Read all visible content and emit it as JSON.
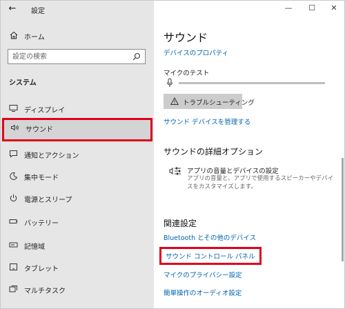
{
  "window": {
    "app_title": "設定",
    "back_icon": "arrow-left-icon",
    "controls": {
      "minimize_icon": "minimize-icon",
      "maximize_icon": "maximize-icon",
      "close_icon": "close-icon"
    }
  },
  "sidebar": {
    "home_label": "ホーム",
    "search_placeholder": "設定の検索",
    "section_title": "システム",
    "items": [
      {
        "label": "ディスプレイ",
        "icon": "display-icon"
      },
      {
        "label": "サウンド",
        "icon": "speaker-icon",
        "selected": true
      },
      {
        "label": "通知とアクション",
        "icon": "notification-icon"
      },
      {
        "label": "集中モード",
        "icon": "moon-icon"
      },
      {
        "label": "電源とスリープ",
        "icon": "power-icon"
      },
      {
        "label": "バッテリー",
        "icon": "battery-icon"
      },
      {
        "label": "記憶域",
        "icon": "storage-icon"
      },
      {
        "label": "タブレット",
        "icon": "tablet-icon"
      },
      {
        "label": "マルチタスク",
        "icon": "multitask-icon"
      }
    ]
  },
  "main": {
    "title": "サウンド",
    "device_properties_link": "デバイスのプロパティ",
    "mic_test_label": "マイクのテスト",
    "mic_level": 0,
    "troubleshoot_button": "トラブルシューティング",
    "manage_devices_link": "サウンド デバイスを管理する",
    "advanced_heading": "サウンドの詳細オプション",
    "app_volume_title": "アプリの音量とデバイスの設定",
    "app_volume_desc": "アプリの音量と、アプリで使用するスピーカーやデバイスをカスタマイズします。",
    "related_heading": "関連設定",
    "related_links": [
      "Bluetooth とその他のデバイス",
      "サウンド コントロール パネル",
      "マイクのプライバシー設定",
      "簡単操作のオーディオ設定"
    ]
  },
  "colors": {
    "accent_link": "#0063b1",
    "highlight": "#e0001a",
    "sidebar_bg": "#e6e6e6"
  }
}
